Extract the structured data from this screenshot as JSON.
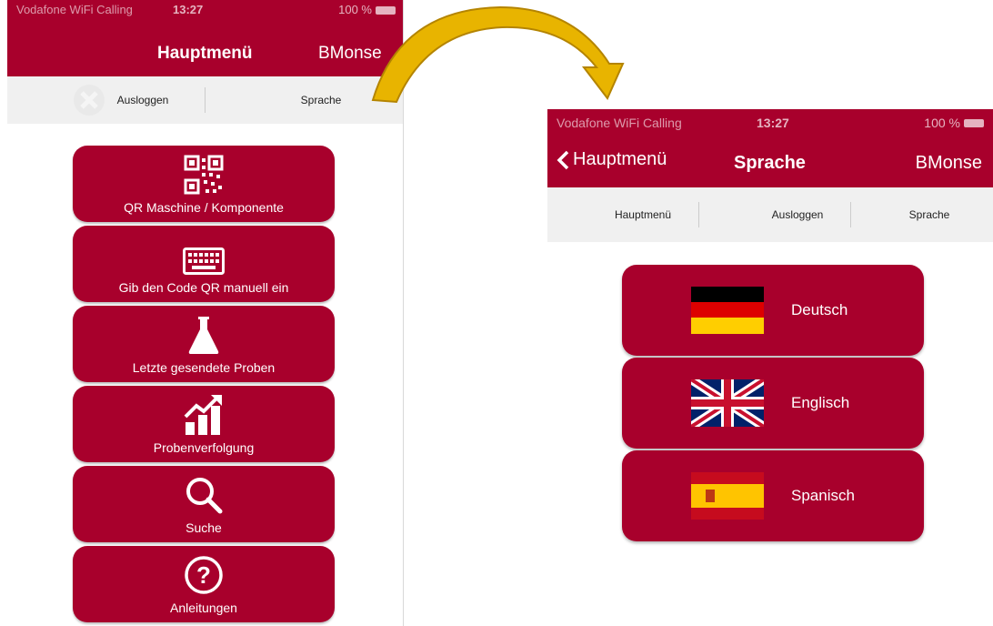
{
  "left": {
    "status": {
      "carrier": "Vodafone WiFi Calling",
      "time": "13:27",
      "battery": "100 %"
    },
    "nav": {
      "title": "Hauptmenü",
      "right": "BMonse"
    },
    "tabs": {
      "logout": "Ausloggen",
      "language": "Sprache"
    },
    "menu": [
      {
        "label": "QR Maschine / Komponente",
        "icon": "qr-code-icon"
      },
      {
        "label": "Gib den Code QR manuell ein",
        "icon": "keyboard-icon"
      },
      {
        "label": "Letzte gesendete Proben",
        "icon": "flask-icon"
      },
      {
        "label": "Probenverfolgung",
        "icon": "growth-chart-icon"
      },
      {
        "label": "Suche",
        "icon": "search-icon"
      },
      {
        "label": "Anleitungen",
        "icon": "help-icon"
      }
    ]
  },
  "right": {
    "status": {
      "carrier": "Vodafone WiFi Calling",
      "time": "13:27",
      "battery": "100 %"
    },
    "nav": {
      "back": "Hauptmenü",
      "title": "Sprache",
      "right": "BMonse"
    },
    "tabs": {
      "main": "Hauptmenü",
      "logout": "Ausloggen",
      "language": "Sprache"
    },
    "languages": [
      {
        "label": "Deutsch",
        "icon": "flag-germany-icon"
      },
      {
        "label": "Englisch",
        "icon": "flag-uk-icon"
      },
      {
        "label": "Spanisch",
        "icon": "flag-spain-icon"
      }
    ]
  },
  "colors": {
    "brand": "#a8002c",
    "arrow": "#e8b400"
  }
}
